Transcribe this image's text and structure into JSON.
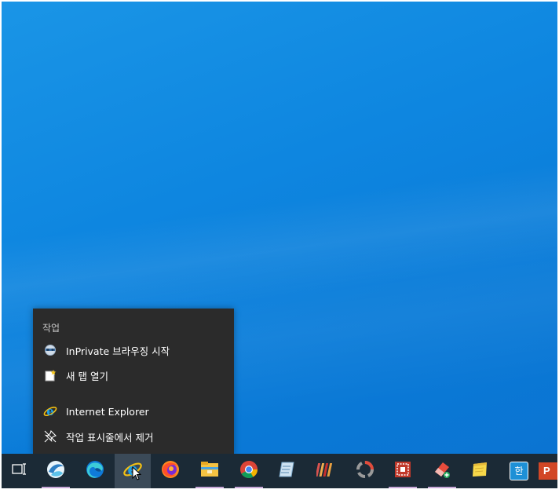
{
  "jumplist": {
    "header": "작업",
    "items": [
      {
        "label": "InPrivate 브라우징 시작",
        "icon": "inprivate-icon"
      },
      {
        "label": "새 탭 열기",
        "icon": "new-tab-icon"
      },
      {
        "label": "Internet Explorer",
        "icon": "internet-explorer-icon"
      },
      {
        "label": "작업 표시줄에서 제거",
        "icon": "unpin-icon"
      }
    ]
  },
  "taskbar": {
    "apps": [
      {
        "name": "task-view-icon"
      },
      {
        "name": "swirl-app-icon",
        "running": true
      },
      {
        "name": "edge-icon"
      },
      {
        "name": "internet-explorer-icon",
        "active": true
      },
      {
        "name": "firefox-icon"
      },
      {
        "name": "file-explorer-icon",
        "running": true
      },
      {
        "name": "chrome-icon",
        "running": true
      },
      {
        "name": "notepad-app-icon"
      },
      {
        "name": "stripes-app-icon"
      },
      {
        "name": "gear-app-icon"
      },
      {
        "name": "red-grid-app-icon",
        "running": true
      },
      {
        "name": "eraser-app-icon",
        "running": true
      },
      {
        "name": "sticky-notes-icon"
      },
      {
        "name": "hangul-ime-icon",
        "text": "한"
      },
      {
        "name": "powerpoint-icon",
        "text": "P"
      }
    ]
  },
  "colors": {
    "desktop": "#0e86e0",
    "taskbar": "#1b2a36",
    "jumplist": "#2b2b2b"
  }
}
